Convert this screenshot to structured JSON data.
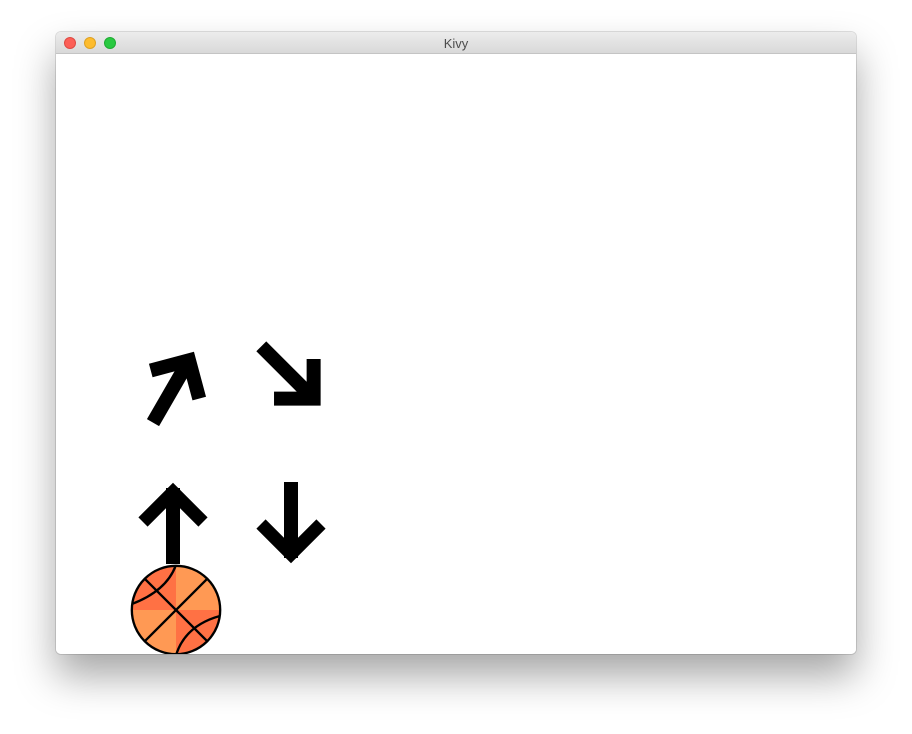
{
  "window": {
    "title": "Kivy"
  },
  "controls": {
    "up_right": "arrow-up-right",
    "down_right": "arrow-down-right",
    "up": "arrow-up",
    "down": "arrow-down",
    "ball": "basketball"
  },
  "colors": {
    "arrow": "#000000",
    "ball_light": "#ff9954",
    "ball_dark": "#ff7144",
    "ball_line": "#000000"
  }
}
